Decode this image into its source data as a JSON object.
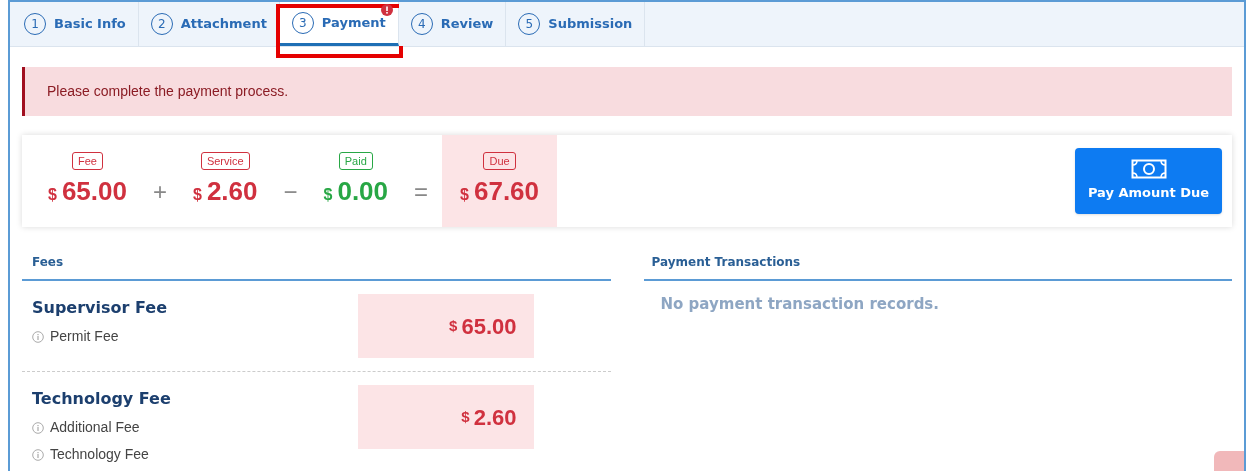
{
  "tabs": [
    {
      "number": "1",
      "label": "Basic Info",
      "selected": false,
      "alert": false,
      "highlighted": false
    },
    {
      "number": "2",
      "label": "Attachment",
      "selected": false,
      "alert": false,
      "highlighted": false
    },
    {
      "number": "3",
      "label": "Payment",
      "selected": true,
      "alert": true,
      "highlighted": true
    },
    {
      "number": "4",
      "label": "Review",
      "selected": false,
      "alert": false,
      "highlighted": false
    },
    {
      "number": "5",
      "label": "Submission",
      "selected": false,
      "alert": false,
      "highlighted": false
    }
  ],
  "alert": {
    "message": "Please complete the payment process."
  },
  "summary": [
    {
      "kind": "amount",
      "tag": "Fee",
      "currency": "$",
      "amount": "65.00",
      "color": "#d0313f",
      "emphasized": false
    },
    {
      "kind": "operator",
      "symbol": "+"
    },
    {
      "kind": "amount",
      "tag": "Service",
      "currency": "$",
      "amount": "2.60",
      "color": "#d0313f",
      "emphasized": false
    },
    {
      "kind": "operator",
      "symbol": "−"
    },
    {
      "kind": "amount",
      "tag": "Paid",
      "currency": "$",
      "amount": "0.00",
      "color": "#28a745",
      "emphasized": false
    },
    {
      "kind": "operator",
      "symbol": "="
    },
    {
      "kind": "amount",
      "tag": "Due",
      "currency": "$",
      "amount": "67.60",
      "color": "#d0313f",
      "emphasized": true
    }
  ],
  "pay_button": {
    "label": "Pay Amount Due"
  },
  "fees": {
    "title": "Fees",
    "items": [
      {
        "name": "Supervisor Fee",
        "details": [
          "Permit Fee"
        ],
        "currency": "$",
        "amount": "65.00"
      },
      {
        "name": "Technology Fee",
        "details": [
          "Additional Fee",
          "Technology Fee"
        ],
        "currency": "$",
        "amount": "2.60"
      }
    ]
  },
  "transactions": {
    "title": "Payment Transactions",
    "empty_message": "No payment transaction records."
  }
}
